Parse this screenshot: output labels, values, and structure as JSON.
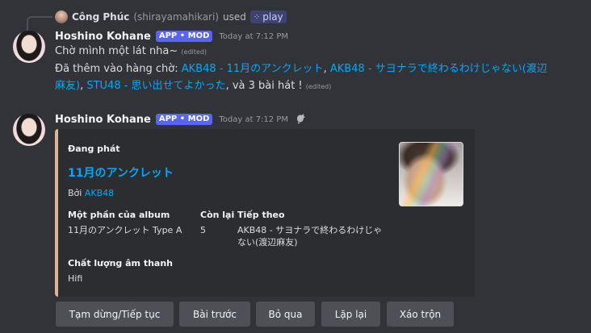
{
  "reply": {
    "user_name": "Công Phúc",
    "user_handle": "(shirayamahikari)",
    "used_text": "used",
    "command": "play",
    "command_icon": "app-command-icon"
  },
  "messages": [
    {
      "author": "Hoshino Kohane",
      "badge": "APP • MOD",
      "timestamp": "Today at 7:12 PM",
      "line1": "Chờ mình một lát nha~",
      "edited": "(edited)",
      "line2_prefix": "Đã thêm vào hàng chờ: ",
      "songs": [
        "AKB48 - 11月のアンクレット",
        "AKB48 - サヨナラで終わるわけじゃない(渡辺麻友)",
        "STU48 - 思い出せてよかった"
      ],
      "sep": ", ",
      "line2_suffix": ", và 3 bài hát !",
      "edited2": "(edited)"
    },
    {
      "author": "Hoshino Kohane",
      "badge": "APP • MOD",
      "timestamp": "Today at 7:12 PM",
      "status_icon": "ephemeral-icon"
    }
  ],
  "embed": {
    "accent_color": "#e0b68c",
    "author": "Đang phát",
    "title": "11月のアンクレット",
    "by_label": "Bởi",
    "artist": "AKB48",
    "fields": {
      "album_name": "Một phần của album",
      "album_value": "11月のアンクレット Type A",
      "left_name": "Còn lại",
      "left_value": "5",
      "next_name": "Tiếp theo",
      "next_value": "AKB48 - サヨナラで終わるわけじゃない(渡辺麻友)",
      "quality_name": "Chất lượng âm thanh",
      "quality_value": "Hifi"
    }
  },
  "buttons": {
    "pause": "Tạm dừng/Tiếp tục",
    "prev": "Bài trước",
    "skip": "Bỏ qua",
    "loop": "Lặp lại",
    "shuffle": "Xáo trộn"
  },
  "colors": {
    "background": "#313338",
    "link": "#00a8fc",
    "badge": "#5865f2",
    "button": "#4e5058"
  }
}
